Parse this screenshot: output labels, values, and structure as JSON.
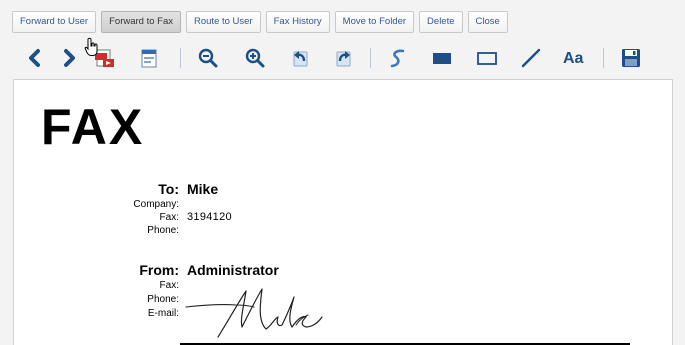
{
  "action_bar": {
    "buttons": [
      {
        "label": "Forward to User"
      },
      {
        "label": "Forward to Fax"
      },
      {
        "label": "Route to User"
      },
      {
        "label": "Fax History"
      },
      {
        "label": "Move to Folder"
      },
      {
        "label": "Delete"
      },
      {
        "label": "Close"
      }
    ],
    "active_index": 1
  },
  "toolbar": {
    "icons": [
      "previous-page-icon",
      "next-page-icon",
      "pdf-export-icon",
      "fax-page-icon",
      "zoom-out-icon",
      "zoom-in-icon",
      "rotate-left-icon",
      "rotate-right-icon",
      "freehand-draw-icon",
      "filled-rectangle-icon",
      "rectangle-outline-icon",
      "line-icon",
      "text-annotation-icon",
      "save-icon"
    ],
    "text_tool_label": "Aa",
    "accent_color": "#1d4f86",
    "highlight_color": "#3a78c2"
  },
  "document": {
    "heading": "FAX",
    "to": {
      "label": "To:",
      "value": "Mike",
      "company_label": "Company:",
      "company_value": "",
      "fax_label": "Fax:",
      "fax_value": "3194120",
      "phone_label": "Phone:",
      "phone_value": ""
    },
    "from": {
      "label": "From:",
      "value": "Administrator",
      "fax_label": "Fax:",
      "fax_value": "",
      "phone_label": "Phone:",
      "phone_value": "",
      "email_label": "E-mail:",
      "email_value": ""
    },
    "signature_text": "Mike"
  }
}
